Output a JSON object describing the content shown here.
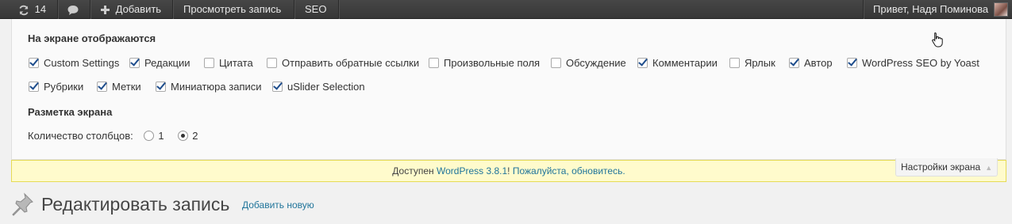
{
  "adminbar": {
    "updates_count": "14",
    "add_label": "Добавить",
    "view_post_label": "Просмотреть запись",
    "seo_label": "SEO",
    "greeting": "Привет, Надя Поминова",
    "icons": {
      "updates": "refresh-icon",
      "comments": "comment-bubble-icon",
      "add": "plus-icon"
    }
  },
  "screen_options": {
    "boxes_heading": "На экране отображаются",
    "boxes": [
      {
        "label": "Custom Settings",
        "checked": true
      },
      {
        "label": "Редакции",
        "checked": true
      },
      {
        "label": "Цитата",
        "checked": false
      },
      {
        "label": "Отправить обратные ссылки",
        "checked": false
      },
      {
        "label": "Произвольные поля",
        "checked": false
      },
      {
        "label": "Обсуждение",
        "checked": false
      },
      {
        "label": "Комментарии",
        "checked": true
      },
      {
        "label": "Ярлык",
        "checked": false
      },
      {
        "label": "Автор",
        "checked": true
      },
      {
        "label": "WordPress SEO by Yoast",
        "checked": true
      },
      {
        "label": "Рубрики",
        "checked": true
      },
      {
        "label": "Метки",
        "checked": true
      },
      {
        "label": "Миниатюра записи",
        "checked": true
      },
      {
        "label": "uSlider Selection",
        "checked": true
      }
    ],
    "layout_heading": "Разметка экрана",
    "columns_label": "Количество столбцов:",
    "columns_options": [
      "1",
      "2"
    ],
    "columns_selected": "2"
  },
  "update_nag": {
    "prefix": "Доступен",
    "link_text": "WordPress 3.8.1",
    "middle": "!",
    "update_link_text": "Пожалуйста, обновитесь."
  },
  "screen_options_tab_label": "Настройки экрана",
  "page": {
    "title": "Редактировать запись",
    "add_new_label": "Добавить новую"
  },
  "colors": {
    "adminbar_bg": "#3a3a3a",
    "link": "#21759b",
    "nag_bg": "#fffbcc"
  }
}
